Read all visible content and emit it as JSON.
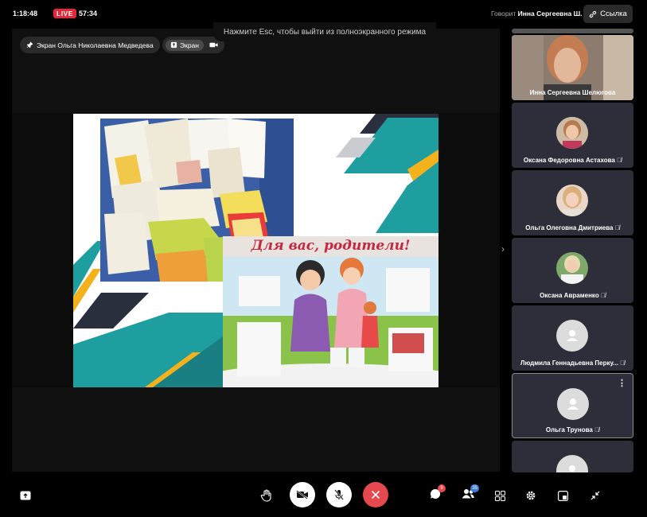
{
  "topbar": {
    "clock": "1:18:48",
    "live_label": "LIVE",
    "timer": "57:34",
    "speaking_prefix": "Говорит",
    "speaking_name": "Инна Сергеевна Ш.",
    "link_label": "Ссылка"
  },
  "esc_hint": "Нажмите Esc, чтобы выйти из полноэкранного режима",
  "stage": {
    "pin_label": "Экран Ольга Николаевна Медведева",
    "screen_label": "Экран",
    "poster_title": "Для вас, родители!"
  },
  "participants": [
    {
      "name": "Инна Сергеевна Шелюгова",
      "type": "video",
      "muted": false
    },
    {
      "name": "Оксана Федоровна Астахова",
      "type": "photo",
      "muted": true
    },
    {
      "name": "Ольга Олеговна Дмитриева",
      "type": "photo",
      "muted": true
    },
    {
      "name": "Оксана Авраменко",
      "type": "photo",
      "muted": true
    },
    {
      "name": "Людмила Геннадьевна Перку...",
      "type": "placeholder",
      "muted": true
    },
    {
      "name": "Ольга Трунова",
      "type": "placeholder",
      "muted": true
    }
  ],
  "toolbar": {
    "chat_badge": "9",
    "participants_badge": "35"
  },
  "colors": {
    "live": "#e8263a",
    "end_call": "#e5484d",
    "slide_teal": "#1f9ea0",
    "slide_dark": "#2a2f3d",
    "slide_yellow": "#f3b21b"
  }
}
